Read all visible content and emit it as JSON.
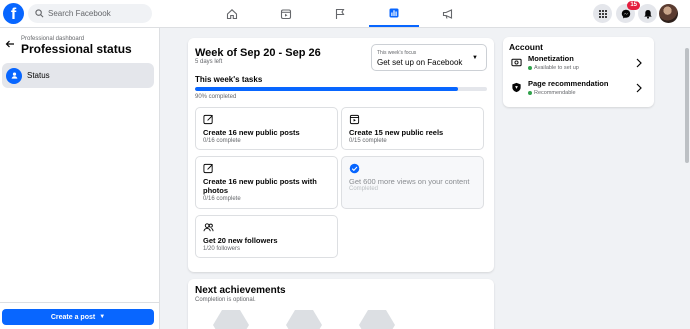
{
  "header": {
    "logo": "f",
    "search_placeholder": "Search Facebook",
    "nav_icons": [
      "home-icon",
      "video-icon",
      "flag-icon",
      "dashboard-icon",
      "megaphone-icon"
    ],
    "active_nav": "dashboard-icon",
    "messenger_badge": "15",
    "accent": "#0866ff"
  },
  "sidebar": {
    "breadcrumb": "Professional dashboard",
    "title": "Professional status",
    "items": [
      {
        "label": "Status",
        "icon": "status-icon"
      }
    ],
    "create_post": "Create a post"
  },
  "main": {
    "week_title": "Week of Sep 20 - Sep 26",
    "days_left": "5 days left",
    "focus_label": "This week's focus",
    "focus_value": "Get set up on Facebook",
    "tasks_title": "This week's tasks",
    "progress_text": "90% completed",
    "progress_value": 0.9,
    "tasks": [
      {
        "name": "Create 16 new public posts",
        "sub": "0/16 complete",
        "icon": "edit-icon",
        "done": false
      },
      {
        "name": "Create 15 new public reels",
        "sub": "0/15 complete",
        "icon": "reel-icon",
        "done": false
      },
      {
        "name": "Create 16 new public posts with photos",
        "sub": "0/16 complete",
        "icon": "edit-icon",
        "done": false
      },
      {
        "name": "Get 600 more views on your content",
        "sub": "Completed",
        "icon": "check-icon",
        "done": true
      },
      {
        "name": "Get 20 new followers",
        "sub": "1/20 followers",
        "icon": "people-icon",
        "done": false
      }
    ]
  },
  "achievements": {
    "title": "Next achievements",
    "subtitle": "Completion is optional."
  },
  "account": {
    "title": "Account",
    "rows": [
      {
        "name": "Monetization",
        "status": "Available to set up",
        "icon": "money-icon"
      },
      {
        "name": "Page recommendation",
        "status": "Recommendable",
        "icon": "shield-icon"
      }
    ]
  }
}
